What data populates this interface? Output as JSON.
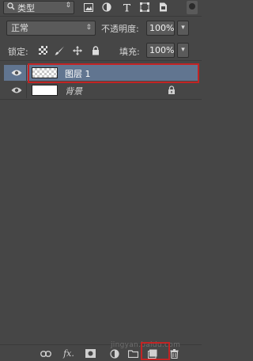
{
  "filter": {
    "type_label": "类型"
  },
  "blend": {
    "mode": "正常"
  },
  "opacity": {
    "label": "不透明度:",
    "value": "100%"
  },
  "lock": {
    "label": "锁定:"
  },
  "fill": {
    "label": "填充:",
    "value": "100%"
  },
  "layers": [
    {
      "name": "图层 1",
      "selected": true,
      "visible": true,
      "thumbnail": "transparent"
    },
    {
      "name": "背景",
      "selected": false,
      "visible": true,
      "locked": true,
      "thumbnail": "white"
    }
  ],
  "watermark": "jingyan.baidu.com",
  "icons": {
    "filter_toolbar": [
      "image-filter-icon",
      "adjustment-filter-icon",
      "type-filter-icon",
      "shape-filter-icon",
      "smart-object-filter-icon"
    ],
    "lock_toolbar": [
      "lock-transparent-icon",
      "lock-image-icon",
      "lock-position-icon",
      "lock-all-icon"
    ],
    "bottom_toolbar": [
      "link-layers-icon",
      "fx-icon",
      "add-mask-icon",
      "adjustment-layer-icon",
      "new-group-icon",
      "new-layer-icon",
      "delete-icon"
    ]
  },
  "colors": {
    "panel_bg": "#464646",
    "selected_row": "#617590",
    "highlight_border": "#c22424"
  }
}
